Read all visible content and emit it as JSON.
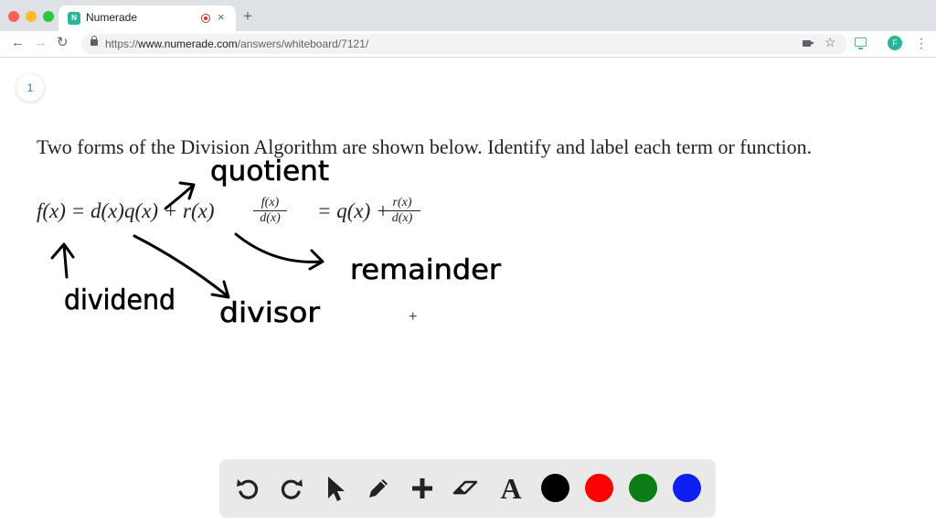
{
  "browser": {
    "tab_title": "Numerade",
    "favicon_letter": "N",
    "new_tab_label": "+",
    "close_label": "×",
    "url_scheme": "https://",
    "url_host": "www.numerade.com",
    "url_path": "/answers/whiteboard/7121/",
    "profile_initial": "F"
  },
  "whiteboard": {
    "page_number": "1",
    "problem_text": "Two forms of the Division Algorithm are shown below. Identify and label each term or function.",
    "equation_main": "f(x) = d(x)q(x) + r(x)",
    "fraction1_numerator": "f(x)",
    "fraction1_denominator": "d(x)",
    "equation_rhs": "= q(x) +",
    "fraction2_numerator": "r(x)",
    "fraction2_denominator": "d(x)",
    "handwritten_labels": {
      "quotient": "quotient",
      "remainder": "remainder",
      "dividend": "dividend",
      "divisor": "divisor"
    },
    "ink_color": "#000000"
  },
  "palette": {
    "tools": [
      "undo-icon",
      "redo-icon",
      "pointer-icon",
      "pen-icon",
      "plus-icon",
      "eraser-icon",
      "text-tool-icon"
    ],
    "text_tool_glyph": "A",
    "colors": [
      "#000000",
      "#ff0000",
      "#0a7d16",
      "#0f1ff2"
    ]
  }
}
